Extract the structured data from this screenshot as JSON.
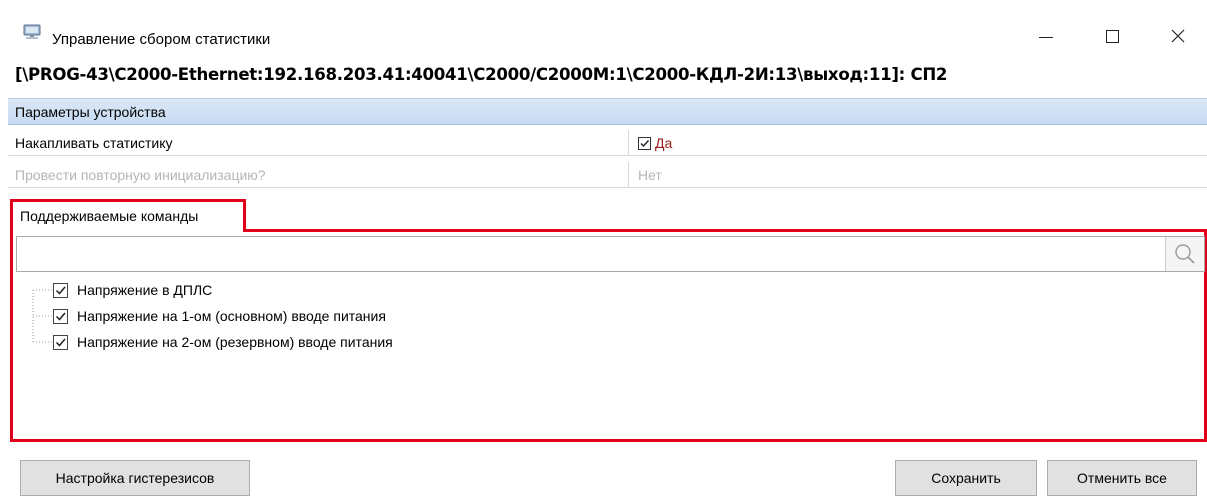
{
  "window": {
    "title": "Управление сбором статистики",
    "icon": "statistics-monitor-icon"
  },
  "device_path": "[\\PROG-43\\C2000-Ethernet:192.168.203.41:40041\\C2000/C2000M:1\\C2000-КДЛ-2И:13\\выход:11]: СП2",
  "properties": {
    "section_title": "Параметры устройства",
    "rows": [
      {
        "name": "Накапливать статистику",
        "value": "Да",
        "checked": true,
        "enabled": true
      },
      {
        "name": "Провести повторную инициализацию?",
        "value": "Нет",
        "enabled": false
      }
    ]
  },
  "commands_tab": {
    "label": "Поддерживаемые команды",
    "search_placeholder": "",
    "items": [
      {
        "label": "Напряжение в ДПЛС",
        "checked": true
      },
      {
        "label": "Напряжение на 1-ом (основном) вводе питания",
        "checked": true
      },
      {
        "label": "Напряжение на 2-ом (резервном) вводе питания",
        "checked": true
      }
    ]
  },
  "buttons": {
    "hysteresis": "Настройка гистерезисов",
    "save": "Сохранить",
    "cancel_all": "Отменить все"
  },
  "colors": {
    "highlight_border": "#e0001b",
    "section_header": "#cfe0f5",
    "value_text": "#9b1b1b"
  }
}
